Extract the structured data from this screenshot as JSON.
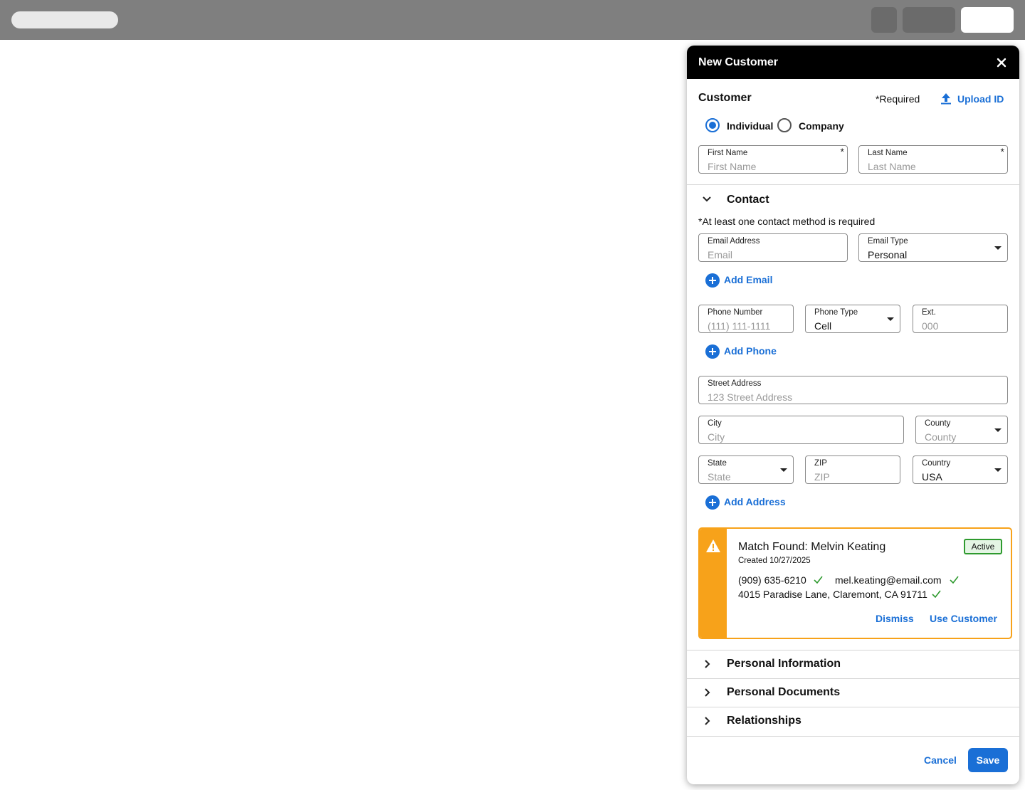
{
  "panel": {
    "title": "New Customer"
  },
  "customer": {
    "heading": "Customer",
    "required_note": "*Required",
    "upload_label": "Upload ID",
    "types": [
      "Individual",
      "Company"
    ],
    "selected_type": "Individual",
    "first_name": {
      "label": "First Name",
      "placeholder": "First Name",
      "star": "*"
    },
    "last_name": {
      "label": "Last Name",
      "placeholder": "Last Name",
      "star": "*"
    }
  },
  "contact": {
    "heading": "Contact",
    "note": "*At least one contact method is required",
    "email": {
      "label": "Email Address",
      "placeholder": "Email"
    },
    "email_type": {
      "label": "Email Type",
      "value": "Personal"
    },
    "add_email": "Add Email",
    "phone": {
      "label": "Phone Number",
      "placeholder": "(111) 111-1111"
    },
    "phone_type": {
      "label": "Phone Type",
      "value": "Cell"
    },
    "ext": {
      "label": "Ext.",
      "placeholder": "000"
    },
    "add_phone": "Add Phone",
    "street": {
      "label": "Street Address",
      "placeholder": "123 Street Address"
    },
    "city": {
      "label": "City",
      "placeholder": "City"
    },
    "county": {
      "label": "County",
      "placeholder": "County"
    },
    "state": {
      "label": "State",
      "placeholder": "State"
    },
    "zip": {
      "label": "ZIP",
      "placeholder": "ZIP"
    },
    "country": {
      "label": "Country",
      "value": "USA"
    },
    "add_address": "Add Address"
  },
  "match": {
    "title": "Match Found: Melvin Keating",
    "created": "Created 10/27/2025",
    "status": "Active",
    "phone": "(909) 635-6210",
    "email": "mel.keating@email.com",
    "address": "4015 Paradise Lane, Claremont, CA 91711",
    "dismiss": "Dismiss",
    "use": "Use Customer",
    "accent_color": "#f7a21a",
    "status_color": "#2e9a2e"
  },
  "sections": [
    "Personal Information",
    "Personal Documents",
    "Relationships"
  ],
  "footer": {
    "cancel": "Cancel",
    "save": "Save"
  },
  "colors": {
    "primary": "#1a6fd6",
    "header_bg": "#000000",
    "topbar_bg": "#7f7f7f"
  }
}
